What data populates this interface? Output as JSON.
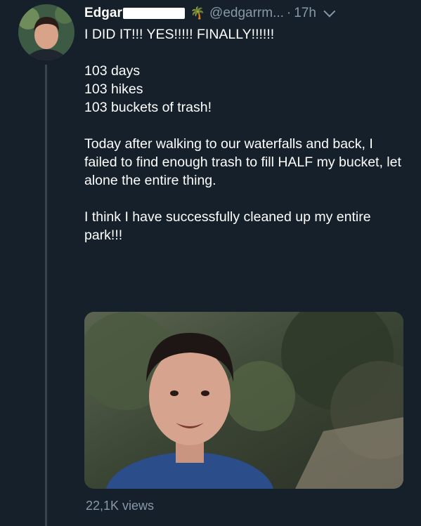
{
  "tweet": {
    "display_name": "Edgar",
    "handle": "@edgarrm...",
    "separator": "·",
    "time": "17h",
    "headline": "I DID IT!!! YES!!!!! FINALLY!!!!!!",
    "stats": [
      "103 days",
      "103 hikes",
      "103 buckets of trash!"
    ],
    "body_1": "Today after walking to our waterfalls and back, I failed to find enough trash to fill HALF my bucket, let alone the entire thing.",
    "body_2": "I think I have successfully cleaned up my entire park!!!",
    "views": "22,1K views"
  },
  "icons": {
    "name_emoji": "palm-tree-icon",
    "menu": "chevron-down-icon"
  },
  "colors": {
    "background": "#15202b",
    "secondary_text": "#8899a6"
  }
}
